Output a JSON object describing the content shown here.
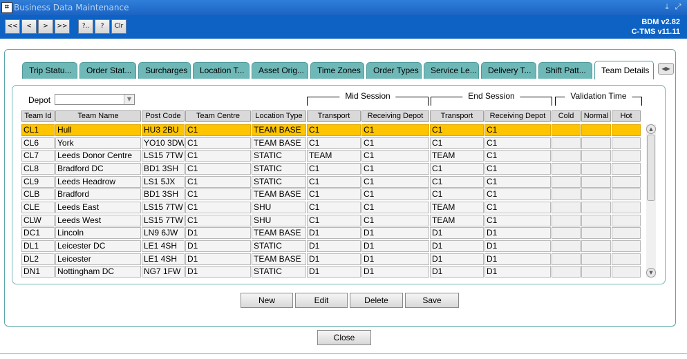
{
  "window": {
    "title": "Business Data Maintenance",
    "icon_label": "BDM"
  },
  "toolbar": {
    "buttons": [
      "<<",
      "<",
      ">",
      ">>",
      "?..",
      "?",
      "Clr"
    ],
    "version_line1": "BDM v2.82",
    "version_line2": "C-TMS v11.11"
  },
  "tabs": [
    "Trip Statu...",
    "Order Stat...",
    "Surcharges",
    "Location T...",
    "Asset Orig...",
    "Time Zones",
    "Order Types",
    "Service Le...",
    "Delivery T...",
    "Shift Patt...",
    "Team Details"
  ],
  "active_tab": "Team Details",
  "depot": {
    "label": "Depot",
    "value": ""
  },
  "groups": {
    "mid": "Mid Session",
    "end": "End Session",
    "validation": "Validation Time"
  },
  "table": {
    "columns": [
      "Team Id",
      "Team Name",
      "Post Code",
      "Team Centre",
      "Location Type",
      "Transport",
      "Receiving Depot",
      "Transport",
      "Receiving Depot",
      "Cold",
      "Normal",
      "Hot"
    ],
    "rows": [
      [
        "CL1",
        "Hull",
        "HU3 2BU",
        "C1",
        "TEAM BASE",
        "C1",
        "C1",
        "C1",
        "C1",
        "",
        "",
        ""
      ],
      [
        "CL6",
        "York",
        "YO10 3DW",
        "C1",
        "TEAM BASE",
        "C1",
        "C1",
        "C1",
        "C1",
        "",
        "",
        ""
      ],
      [
        "CL7",
        "Leeds Donor Centre",
        "LS15 7TW",
        "C1",
        "STATIC",
        "TEAM",
        "C1",
        "TEAM",
        "C1",
        "",
        "",
        ""
      ],
      [
        "CL8",
        "Bradford DC",
        "BD1 3SH",
        "C1",
        "STATIC",
        "C1",
        "C1",
        "C1",
        "C1",
        "",
        "",
        ""
      ],
      [
        "CL9",
        "Leeds Headrow",
        "LS1 5JX",
        "C1",
        "STATIC",
        "C1",
        "C1",
        "C1",
        "C1",
        "",
        "",
        ""
      ],
      [
        "CLB",
        "Bradford",
        "BD1 3SH",
        "C1",
        "TEAM BASE",
        "C1",
        "C1",
        "C1",
        "C1",
        "",
        "",
        ""
      ],
      [
        "CLE",
        "Leeds East",
        "LS15 7TW",
        "C1",
        "SHU",
        "C1",
        "C1",
        "TEAM",
        "C1",
        "",
        "",
        ""
      ],
      [
        "CLW",
        "Leeds West",
        "LS15 7TW",
        "C1",
        "SHU",
        "C1",
        "C1",
        "TEAM",
        "C1",
        "",
        "",
        ""
      ],
      [
        "DC1",
        "Lincoln",
        "LN9 6JW",
        "D1",
        "TEAM BASE",
        "D1",
        "D1",
        "D1",
        "D1",
        "",
        "",
        ""
      ],
      [
        "DL1",
        "Leicester DC",
        "LE1 4SH",
        "D1",
        "STATIC",
        "D1",
        "D1",
        "D1",
        "D1",
        "",
        "",
        ""
      ],
      [
        "DL2",
        "Leicester",
        "LE1 4SH",
        "D1",
        "TEAM BASE",
        "D1",
        "D1",
        "D1",
        "D1",
        "",
        "",
        ""
      ],
      [
        "DN1",
        "Nottingham DC",
        "NG7 1FW",
        "D1",
        "STATIC",
        "D1",
        "D1",
        "D1",
        "D1",
        "",
        "",
        ""
      ]
    ],
    "selected_row": 0
  },
  "actions": {
    "new": "New",
    "edit": "Edit",
    "delete": "Delete",
    "save": "Save",
    "close": "Close"
  },
  "colors": {
    "selected_row": "#ffc400",
    "tab": "#6fb8b8",
    "toolbar": "#0d62c4"
  }
}
